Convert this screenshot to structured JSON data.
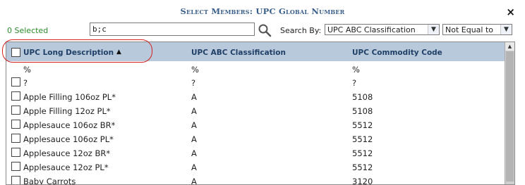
{
  "dialog": {
    "title": "Select Members: UPC Global Number",
    "close_label": "×"
  },
  "toolbar": {
    "selected_count": "0 Selected",
    "search_value": "b;c",
    "search_by_label": "Search By:",
    "search_by_value": "UPC ABC Classification",
    "operator_value": "Not Equal to"
  },
  "icons": {
    "search": "magnifier-icon",
    "sort": "sort-ascending-icon",
    "close": "close-icon"
  },
  "colors": {
    "header_bg": "#b9c9dc",
    "title": "#3a5f8a",
    "selected_count": "#2e8b2e",
    "highlight": "#d42020"
  },
  "grid": {
    "columns": [
      "UPC Long Description",
      "UPC ABC Classification",
      "UPC Commodity Code"
    ],
    "sort_indicator": "▲",
    "rows": [
      [
        "%",
        "%",
        "%"
      ],
      [
        "?",
        "?",
        "?"
      ],
      [
        "Apple Filling 106oz PL*",
        "A",
        "5108"
      ],
      [
        "Apple Filling 12oz PL*",
        "A",
        "5108"
      ],
      [
        "Applesauce 106oz BR*",
        "A",
        "5512"
      ],
      [
        "Applesauce 106oz PL*",
        "A",
        "5512"
      ],
      [
        "Applesauce 12oz BR*",
        "A",
        "5512"
      ],
      [
        "Applesauce 12oz PL*",
        "A",
        "5512"
      ],
      [
        "Baby Carrots",
        "A",
        "3120"
      ]
    ]
  }
}
